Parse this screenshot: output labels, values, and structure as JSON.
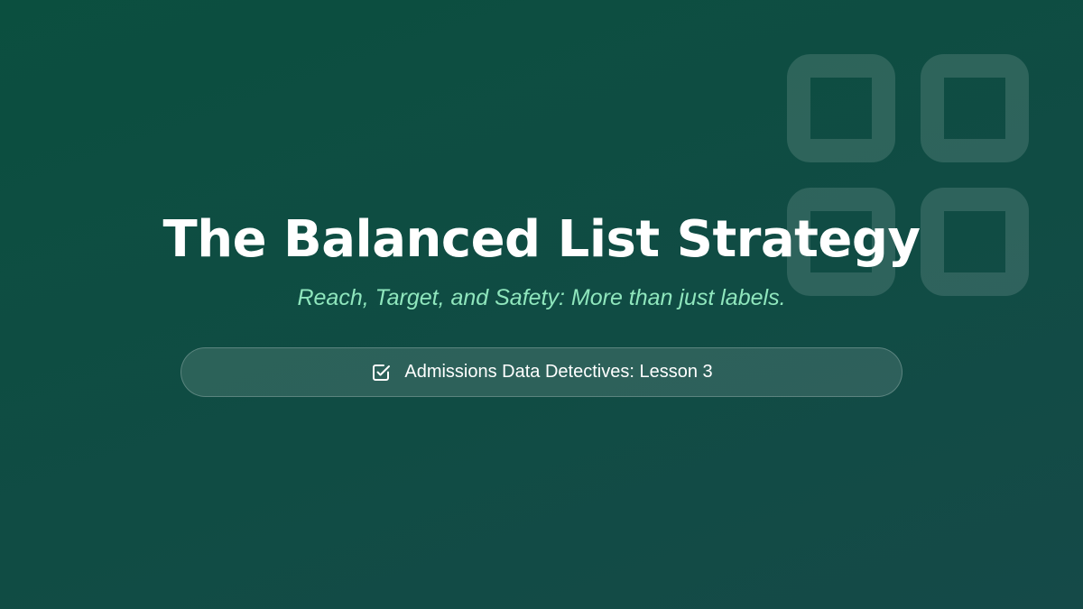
{
  "slide": {
    "title": "The Balanced List Strategy",
    "subtitle": "Reach, Target, and Safety: More than just labels.",
    "badge": {
      "icon": "checkbox-checked-icon",
      "label": "Admissions Data Detectives: Lesson 3"
    },
    "decoration": {
      "icon": "grid-squares-icon"
    }
  },
  "colors": {
    "background": "#0b4f3f",
    "title": "#ffffff",
    "subtitle": "#8fe6bd",
    "badge_text": "#ffffff"
  }
}
